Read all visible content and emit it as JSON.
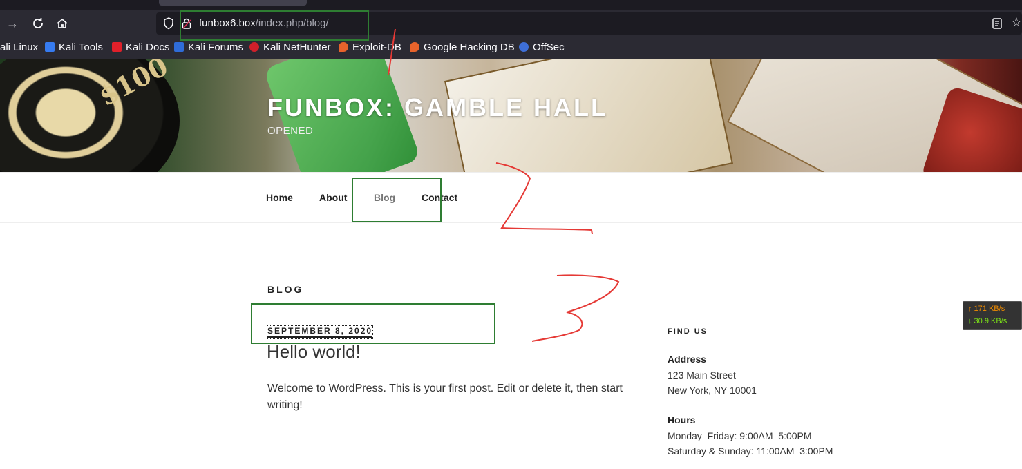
{
  "browser": {
    "url_host": "funbox6.box",
    "url_path": "/index.php/blog/",
    "bookmarks": [
      {
        "label": "ali Linux",
        "icon": "kali-icon",
        "color": "#367bf0"
      },
      {
        "label": "Kali Tools",
        "icon": "kali-tools-icon",
        "color": "#367bf0"
      },
      {
        "label": "Kali Docs",
        "icon": "kali-docs-icon",
        "color": "#e0202a"
      },
      {
        "label": "Kali Forums",
        "icon": "kali-forums-icon",
        "color": "#2f6cd8"
      },
      {
        "label": "Kali NetHunter",
        "icon": "nethunter-icon",
        "color": "#d0202a"
      },
      {
        "label": "Exploit-DB",
        "icon": "exploit-db-icon",
        "color": "#e8632b"
      },
      {
        "label": "Google Hacking DB",
        "icon": "ghdb-icon",
        "color": "#e8632b"
      },
      {
        "label": "OffSec",
        "icon": "offsec-icon",
        "color": "#3e6fd8"
      }
    ]
  },
  "site": {
    "title": "FUNBOX: GAMBLE HALL",
    "tagline": "OPENED",
    "nav": [
      "Home",
      "About",
      "Blog",
      "Contact"
    ],
    "current_nav": "Blog"
  },
  "main": {
    "page_heading": "BLOG",
    "post": {
      "date": "SEPTEMBER 8, 2020",
      "title": "Hello world!",
      "excerpt": "Welcome to WordPress. This is your first post. Edit or delete it, then start writing!"
    }
  },
  "sidebar": {
    "widget_title": "FIND US",
    "address_label": "Address",
    "address_line1": "123 Main Street",
    "address_line2": "New York, NY 10001",
    "hours_label": "Hours",
    "hours_weekday": "Monday–Friday: 9:00AM–5:00PM",
    "hours_weekend": "Saturday & Sunday: 11:00AM–3:00PM"
  },
  "netspeed": {
    "up": "↑ 171 KB/s",
    "down": "↓ 30.9 KB/s"
  },
  "annotations": {
    "marks": [
      "1",
      "2",
      "3"
    ],
    "box_color": "#2e7d32",
    "ink_color": "#e53935"
  }
}
